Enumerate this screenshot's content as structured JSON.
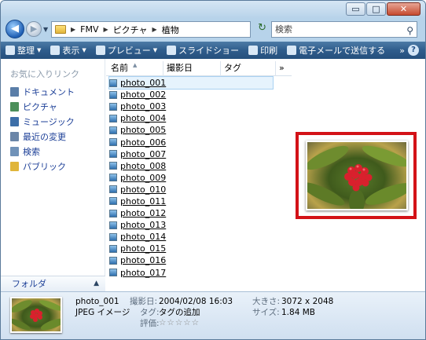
{
  "window": {
    "minimize": "▭",
    "maximize": "□",
    "close": "✕"
  },
  "address": {
    "crumbs": [
      "FMV",
      "ピクチャ",
      "植物"
    ]
  },
  "search": {
    "placeholder": "検索"
  },
  "toolbar": {
    "organize": "整理",
    "views": "表示",
    "preview": "プレビュー",
    "slideshow": "スライドショー",
    "print": "印刷",
    "email": "電子メールで送信する",
    "more": "»",
    "help": "?"
  },
  "nav": {
    "favorites_header": "お気に入りリンク",
    "items": [
      {
        "label": "ドキュメント",
        "icon": "documents-icon",
        "color": "#5a7ea8"
      },
      {
        "label": "ピクチャ",
        "icon": "pictures-icon",
        "color": "#4c8f5a"
      },
      {
        "label": "ミュージック",
        "icon": "music-icon",
        "color": "#3d6fa8"
      },
      {
        "label": "最近の変更",
        "icon": "recent-icon",
        "color": "#6b86a8"
      },
      {
        "label": "検索",
        "icon": "search-folder-icon",
        "color": "#7092b8"
      },
      {
        "label": "パブリック",
        "icon": "public-icon",
        "color": "#e0b53a"
      }
    ],
    "folders_label": "フォルダ"
  },
  "columns": {
    "name": "名前",
    "date_taken": "撮影日",
    "tags": "タグ",
    "more": "»"
  },
  "files": [
    "photo_001",
    "photo_002",
    "photo_003",
    "photo_004",
    "photo_005",
    "photo_006",
    "photo_007",
    "photo_008",
    "photo_009",
    "photo_010",
    "photo_011",
    "photo_012",
    "photo_013",
    "photo_014",
    "photo_015",
    "photo_016",
    "photo_017"
  ],
  "selected_file": "photo_001",
  "details": {
    "name": "photo_001",
    "type": "JPEG イメージ",
    "date_label": "撮影日:",
    "date_value": "2004/02/08 16:03",
    "tag_label": "タグ:",
    "tag_value": "タグの追加",
    "rating_label": "評価:",
    "rating_stars": "☆☆☆☆☆",
    "size_label": "大きさ:",
    "size_value": "3072 x 2048",
    "filesize_label": "サイズ:",
    "filesize_value": "1.84 MB"
  },
  "colors": {
    "highlight": "#d31217",
    "toolbar": "#2f5d8c",
    "link": "#1c3f97"
  }
}
